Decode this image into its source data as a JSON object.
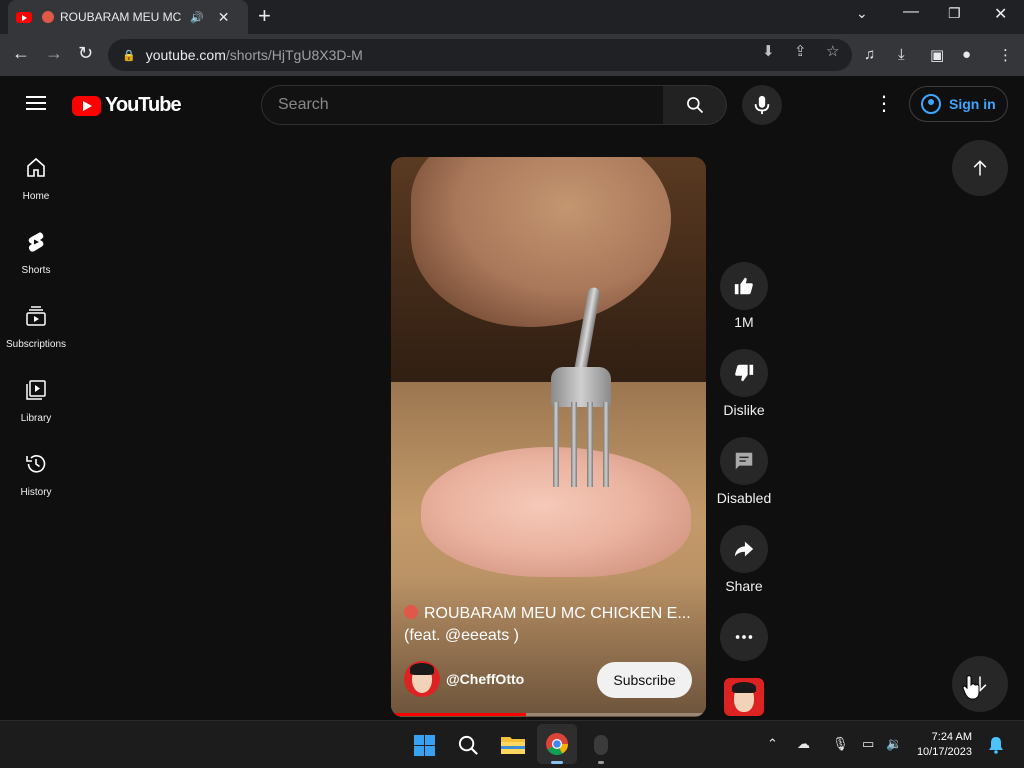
{
  "browser": {
    "tab_title": "ROUBARAM MEU MC CI",
    "url_host": "youtube.com",
    "url_path": "/shorts/HjTgU8X3D-M"
  },
  "header": {
    "logo_text": "YouTube",
    "search_placeholder": "Search",
    "sign_in_label": "Sign in"
  },
  "sidebar": {
    "items": [
      {
        "label": "Home"
      },
      {
        "label": "Shorts"
      },
      {
        "label": "Subscriptions"
      },
      {
        "label": "Library"
      },
      {
        "label": "History"
      }
    ]
  },
  "short": {
    "title_line1": "ROUBARAM MEU MC CHICKEN E...",
    "title_line2": "(feat. @eeeats )",
    "channel": "@CheffOtto",
    "subscribe_label": "Subscribe",
    "progress_fraction": 0.43
  },
  "actions": {
    "like_count": "1M",
    "dislike_label": "Dislike",
    "comments_label": "Disabled",
    "share_label": "Share"
  },
  "taskbar": {
    "time": "7:24 AM",
    "date": "10/17/2023"
  },
  "colors": {
    "brand_red": "#ff0000",
    "link_blue": "#3ea6ff",
    "background": "#0f0f0f"
  }
}
